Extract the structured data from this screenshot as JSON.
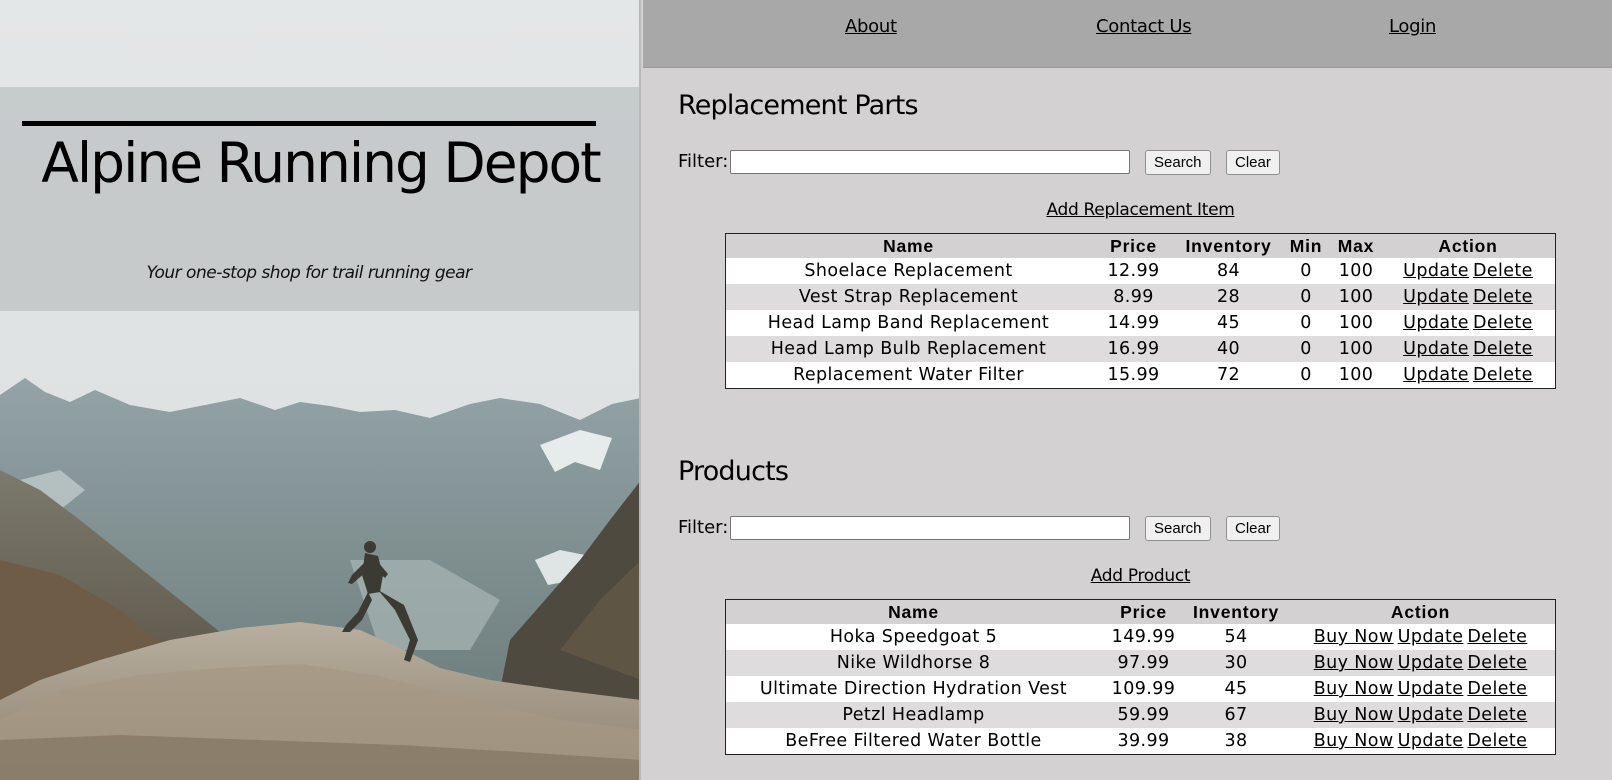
{
  "hero": {
    "title": "Alpine Running Depot",
    "tagline": "Your one-stop shop for trail running gear"
  },
  "nav": {
    "about": "About",
    "contact": "Contact Us",
    "login": "Login"
  },
  "parts": {
    "title": "Replacement Parts",
    "filter_label": "Filter:",
    "filter_value": "",
    "search_label": "Search",
    "clear_label": "Clear",
    "add_label": "Add Replacement Item",
    "columns": [
      "Name",
      "Price",
      "Inventory",
      "Min",
      "Max",
      "Action"
    ],
    "rows": [
      {
        "name": "Shoelace Replacement",
        "price": "12.99",
        "inventory": "84",
        "min": "0",
        "max": "100"
      },
      {
        "name": "Vest Strap Replacement",
        "price": "8.99",
        "inventory": "28",
        "min": "0",
        "max": "100"
      },
      {
        "name": "Head Lamp Band Replacement",
        "price": "14.99",
        "inventory": "45",
        "min": "0",
        "max": "100"
      },
      {
        "name": "Head Lamp Bulb Replacement",
        "price": "16.99",
        "inventory": "40",
        "min": "0",
        "max": "100"
      },
      {
        "name": "Replacement Water Filter",
        "price": "15.99",
        "inventory": "72",
        "min": "0",
        "max": "100"
      }
    ],
    "actions": [
      "Update",
      "Delete"
    ]
  },
  "products": {
    "title": "Products",
    "filter_label": "Filter:",
    "filter_value": "",
    "search_label": "Search",
    "clear_label": "Clear",
    "add_label": "Add Product",
    "columns": [
      "Name",
      "Price",
      "Inventory",
      "Action"
    ],
    "rows": [
      {
        "name": "Hoka Speedgoat 5",
        "price": "149.99",
        "inventory": "54"
      },
      {
        "name": "Nike Wildhorse 8",
        "price": "97.99",
        "inventory": "30"
      },
      {
        "name": "Ultimate Direction Hydration Vest",
        "price": "109.99",
        "inventory": "45"
      },
      {
        "name": "Petzl Headlamp",
        "price": "59.99",
        "inventory": "67"
      },
      {
        "name": "BeFree Filtered Water Bottle",
        "price": "39.99",
        "inventory": "38"
      }
    ],
    "actions": [
      "Buy Now",
      "Update",
      "Delete"
    ]
  },
  "colors": {
    "page_bg": "#d3d1d2",
    "nav_bg": "#a8a8a8",
    "hero_band": "#c4c8c9",
    "row_alt": "#dedcdd"
  }
}
